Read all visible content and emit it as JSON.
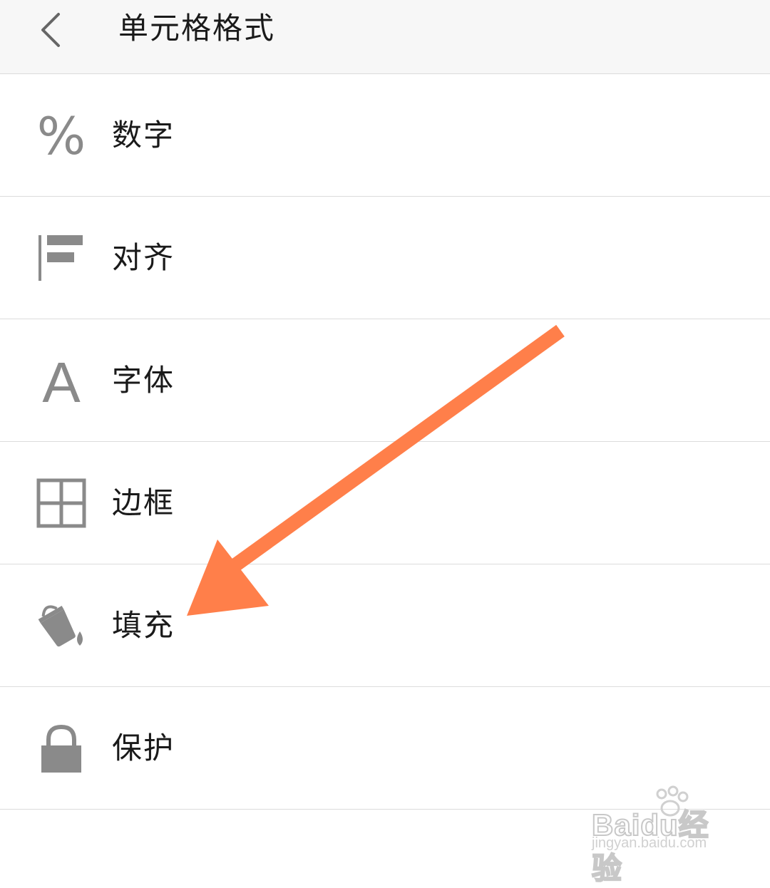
{
  "header": {
    "title": "单元格格式",
    "back_icon": "chevron-left-icon"
  },
  "menu": {
    "items": [
      {
        "label": "数字",
        "icon": "percent-icon"
      },
      {
        "label": "对齐",
        "icon": "align-left-icon"
      },
      {
        "label": "字体",
        "icon": "font-icon"
      },
      {
        "label": "边框",
        "icon": "border-grid-icon"
      },
      {
        "label": "填充",
        "icon": "paint-bucket-icon"
      },
      {
        "label": "保护",
        "icon": "lock-icon"
      }
    ]
  },
  "annotation": {
    "arrow_color": "#ff7f4a",
    "points_to": "填充"
  },
  "watermark": {
    "brand": "Baidu经验",
    "url": "jingyan.baidu.com"
  },
  "colors": {
    "icon": "#8a8a8a",
    "text": "#1a1a1a",
    "divider": "#dcdcdc",
    "header_bg": "#f7f7f7"
  }
}
